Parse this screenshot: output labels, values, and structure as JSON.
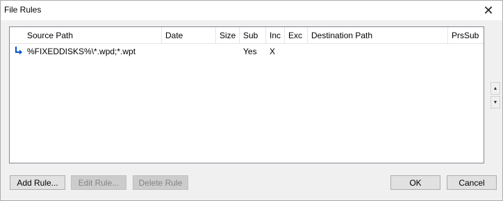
{
  "window": {
    "title": "File Rules",
    "close_glyph": "✕"
  },
  "columns": [
    {
      "key": "source_path",
      "label": "Source Path"
    },
    {
      "key": "date",
      "label": "Date"
    },
    {
      "key": "size",
      "label": "Size"
    },
    {
      "key": "sub",
      "label": "Sub"
    },
    {
      "key": "inc",
      "label": "Inc"
    },
    {
      "key": "exc",
      "label": "Exc"
    },
    {
      "key": "destination_path",
      "label": "Destination Path"
    },
    {
      "key": "prssub",
      "label": "PrsSub"
    }
  ],
  "rows": [
    {
      "icon": "return-arrow-icon",
      "source_path": "%FIXEDDISKS%\\*.wpd;*.wpt",
      "date": "",
      "size": "",
      "sub": "Yes",
      "inc": "X",
      "exc": "",
      "destination_path": "",
      "prssub": ""
    }
  ],
  "scroll": {
    "up_glyph": "▲",
    "down_glyph": "▼"
  },
  "buttons": {
    "add_rule": "Add Rule...",
    "edit_rule": "Edit Rule...",
    "delete_rule": "Delete Rule",
    "ok": "OK",
    "cancel": "Cancel"
  },
  "colors": {
    "accent": "#0050c8",
    "disabled_text": "#838383"
  }
}
